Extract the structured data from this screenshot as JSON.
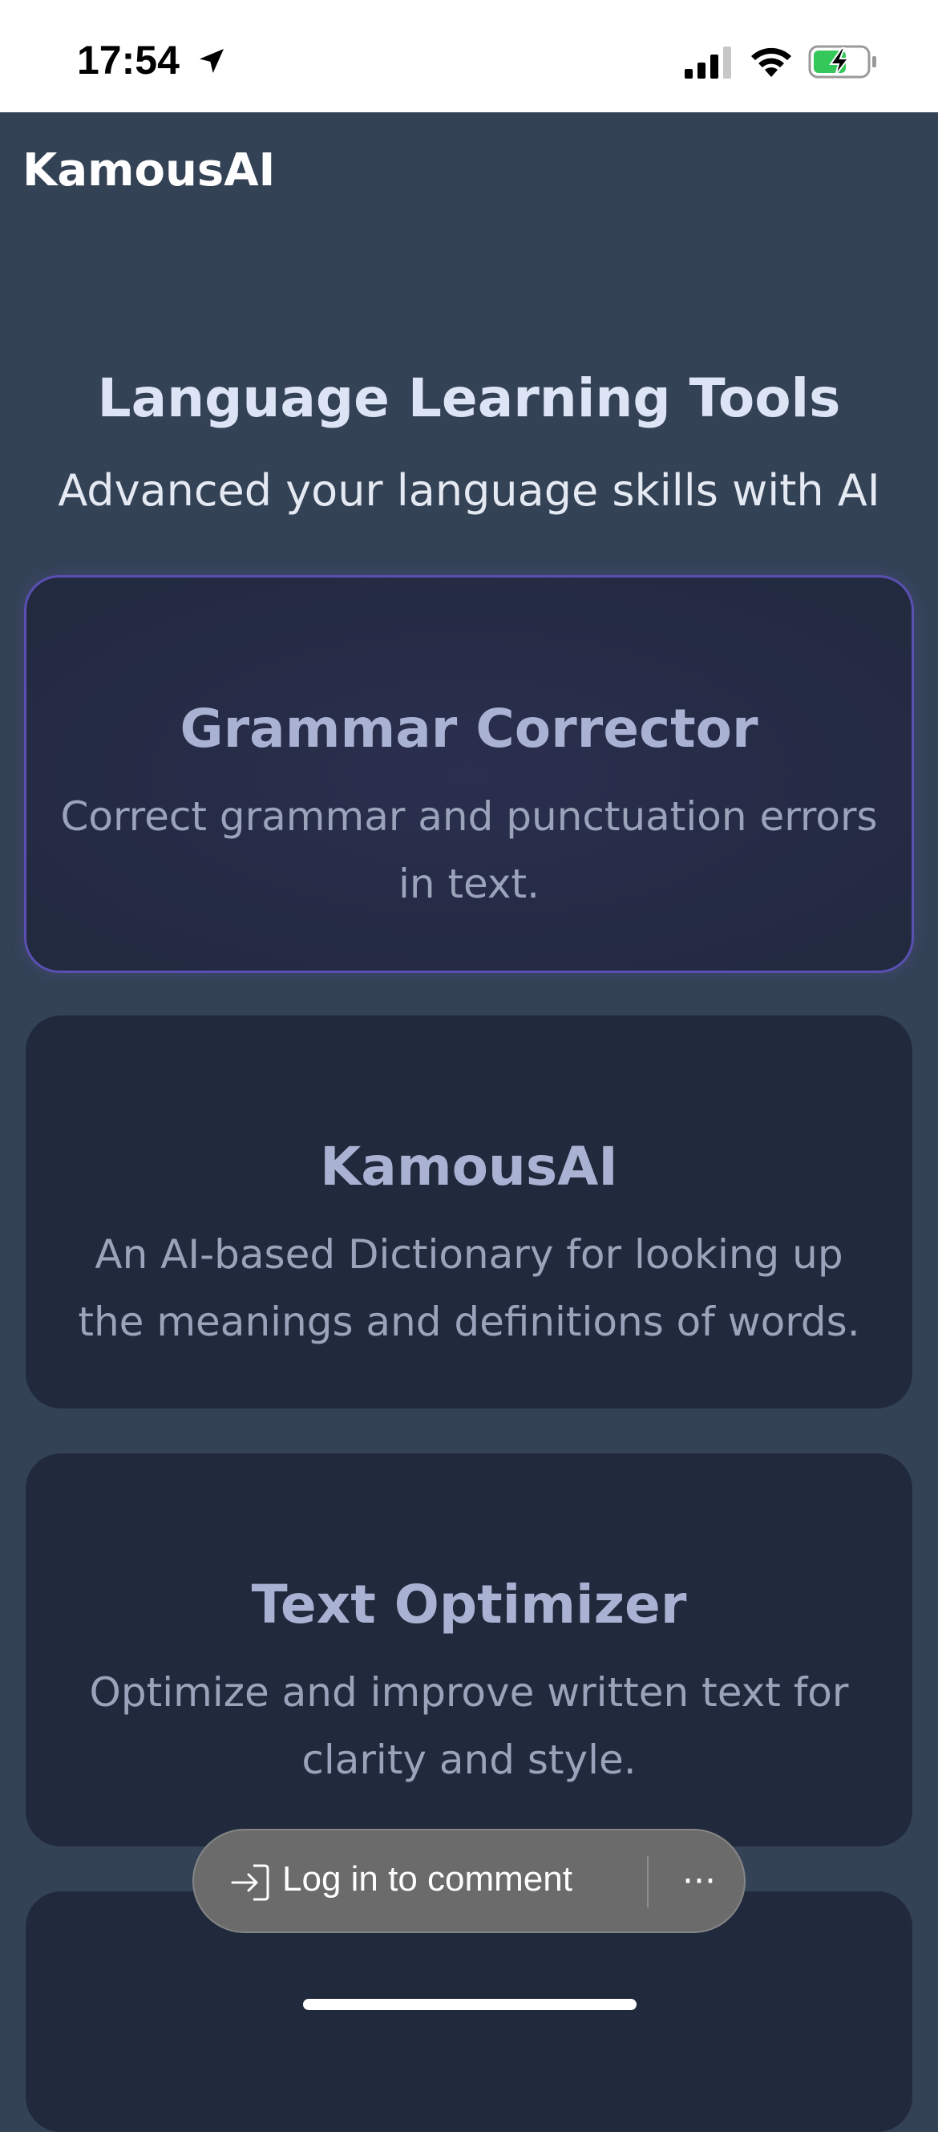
{
  "status_bar": {
    "time": "17:54"
  },
  "header": {
    "brand": "KamousAI"
  },
  "hero": {
    "title": "Language Learning Tools",
    "subtitle": "Advanced your language skills with AI"
  },
  "cards": [
    {
      "title": "Grammar Corrector",
      "description": "Correct grammar and punctuation errors in text."
    },
    {
      "title": "KamousAI",
      "description": "An AI-based Dictionary for looking up the meanings and definitions of words."
    },
    {
      "title": "Text Optimizer",
      "description": "Optimize and improve written text for clarity and style."
    }
  ],
  "comment_bar": {
    "login_label": "Log in to comment",
    "more_icon": "more-horizontal-icon"
  },
  "colors": {
    "background": "#344256",
    "card": "#212a3c",
    "active_border": "#5a4fb2",
    "card_title": "#aab2d3",
    "battery_charging": "#34c759"
  }
}
